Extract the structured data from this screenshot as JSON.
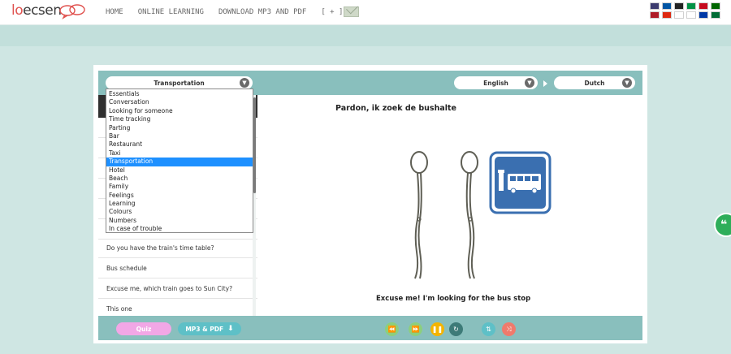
{
  "logo": {
    "text_lo": "lo",
    "text_rest": "ecsen"
  },
  "nav": {
    "items": [
      "HOME",
      "ONLINE LEARNING",
      "DOWNLOAD MP3 AND PDF",
      "[ + ]"
    ]
  },
  "flags": [
    {
      "name": "us-flag",
      "color": "#3c3b6e"
    },
    {
      "name": "fr-flag",
      "color": "#0055a4"
    },
    {
      "name": "de-flag",
      "color": "#222222"
    },
    {
      "name": "it-flag",
      "color": "#009246"
    },
    {
      "name": "es-flag",
      "color": "#c60b1e"
    },
    {
      "name": "pt-flag",
      "color": "#006600"
    },
    {
      "name": "nl-flag",
      "color": "#ae1c28"
    },
    {
      "name": "cn-flag",
      "color": "#de2910"
    },
    {
      "name": "jp-flag",
      "color": "#ffffff"
    },
    {
      "name": "kr-flag",
      "color": "#ffffff"
    },
    {
      "name": "ru-flag",
      "color": "#0039a6"
    },
    {
      "name": "sa-flag",
      "color": "#006c35"
    }
  ],
  "header": {
    "category": "Transportation",
    "language_from": "English",
    "language_to": "Dutch"
  },
  "category_options": [
    "Essentials",
    "Conversation",
    "Looking for someone",
    "Time tracking",
    "Parting",
    "Bar",
    "Restaurant",
    "Taxi",
    "Transportation",
    "Hotel",
    "Beach",
    "Family",
    "Feelings",
    "Learning",
    "Colours",
    "Numbers",
    "In case of trouble"
  ],
  "selected_category_index": 8,
  "phrases": [
    "Do you have the train's time table?",
    "Bus schedule",
    "Excuse me, which train goes to Sun City?",
    "This one"
  ],
  "main": {
    "title": "Pardon, ik zoek de bushalte",
    "caption": "Excuse me! I'm looking for the bus stop"
  },
  "bottom": {
    "quiz_label": "Quiz",
    "mp3_label": "MP3 & PDF"
  },
  "controls": [
    {
      "name": "rewind-icon",
      "glyph": "⏪",
      "color": "#8ccf7d"
    },
    {
      "name": "forward-icon",
      "glyph": "⏩",
      "color": "#8ccf7d"
    },
    {
      "name": "pause-icon",
      "glyph": "❚❚",
      "color": "#f4b400"
    },
    {
      "name": "repeat-icon",
      "glyph": "↻",
      "color": "#3d7b78"
    },
    {
      "name": "swap-icon",
      "glyph": "⇅",
      "color": "#5ec0c7"
    },
    {
      "name": "shuffle-icon",
      "glyph": "⤨",
      "color": "#f07a6c"
    }
  ],
  "colors": {
    "accent": "#89bfbd",
    "selection": "#1e90ff",
    "quiz": "#f2a7e6",
    "mp3": "#5ec0c7",
    "sign": "#3a6fb0"
  }
}
